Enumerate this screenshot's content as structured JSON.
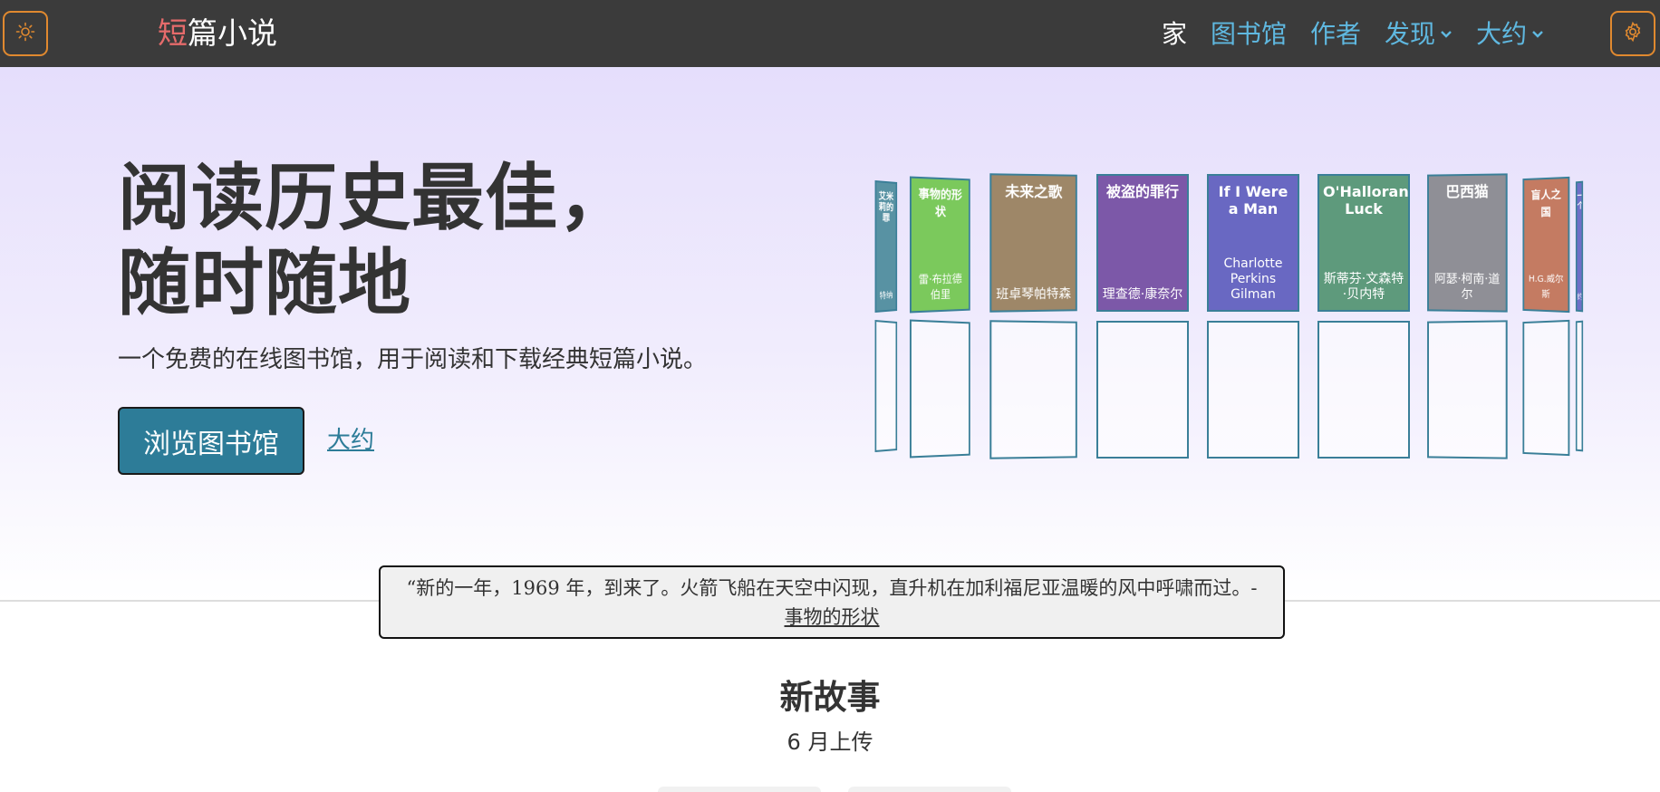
{
  "navbar": {
    "brand_accent": "短",
    "brand_rest": "篇小说",
    "theme_icon": "sun-icon",
    "settings_icon": "gear-icon",
    "links": [
      {
        "label": "家",
        "active": true
      },
      {
        "label": "图书馆"
      },
      {
        "label": "作者"
      },
      {
        "label": "发现",
        "dropdown": true
      },
      {
        "label": "大约",
        "dropdown": true
      }
    ]
  },
  "hero": {
    "title_line1": "阅读历史最佳，",
    "title_line2": "随时随地",
    "subtitle": "一个免费的在线图书馆，用于阅读和下载经典短篇小说。",
    "cta_label": "浏览图书馆",
    "about_label": "大约"
  },
  "books": [
    {
      "title": "艾米莉的罪",
      "author": "特纳",
      "color": "#5892a3"
    },
    {
      "title": "事物的形状",
      "author": "雷·布拉德伯里",
      "color": "#7bc95c"
    },
    {
      "title": "未来之歌",
      "author": "班卓琴帕特森",
      "color": "#9e8768"
    },
    {
      "title": "被盗的罪行",
      "author": "理查德·康奈尔",
      "color": "#7c58a8"
    },
    {
      "title": "If I Were a Man",
      "author": "Charlotte Perkins Gilman",
      "color": "#6968c2"
    },
    {
      "title": "O'Halloran's Luck",
      "author": "斯蒂芬·文森特·贝内特",
      "color": "#5e9a7c"
    },
    {
      "title": "巴西猫",
      "author": "阿瑟·柯南·道尔",
      "color": "#8f8f96"
    },
    {
      "title": "盲人之国",
      "author": "H.G.威尔斯",
      "color": "#c47b62"
    },
    {
      "title": "一个",
      "author": "约",
      "color": "#6e6fc8"
    }
  ],
  "quote": {
    "text": "“新的一年，1969 年，到来了。火箭飞船在天空中闪现，直升机在加利福尼亚温暖的风中呼啸而过。- ",
    "link": "事物的形状"
  },
  "new_stories": {
    "title": "新故事",
    "subtitle": "6 月上传"
  }
}
